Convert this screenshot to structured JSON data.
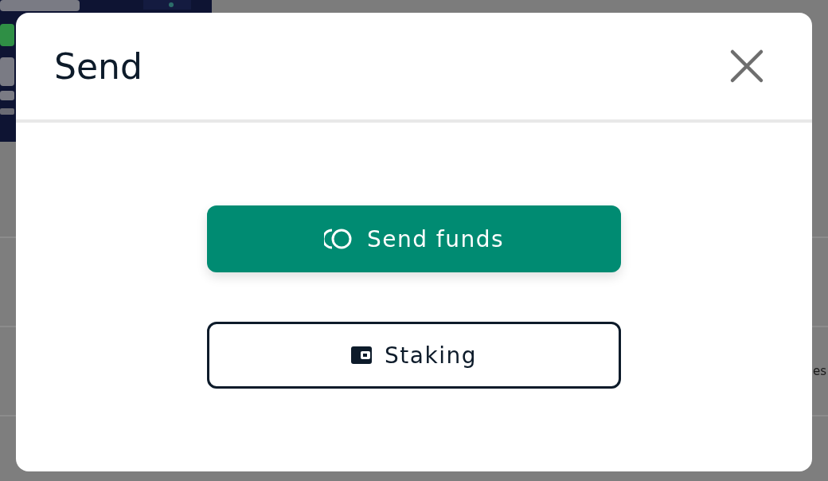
{
  "background": {
    "side_text": "es"
  },
  "modal": {
    "title": "Send",
    "buttons": [
      {
        "label": "Send funds",
        "kind": "primary"
      },
      {
        "label": "Staking",
        "kind": "outline"
      }
    ]
  }
}
